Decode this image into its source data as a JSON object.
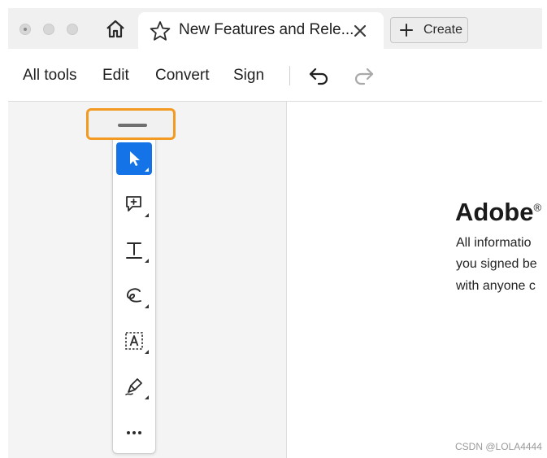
{
  "window": {
    "tab_title": "New Features and Rele...",
    "create_label": "Create"
  },
  "toolbar": {
    "items": [
      "All tools",
      "Edit",
      "Convert",
      "Sign"
    ]
  },
  "document": {
    "heading": "Adobe",
    "lines": [
      "All informatio",
      "you signed be",
      "with anyone c"
    ]
  },
  "rail": {
    "tools": [
      "select-icon",
      "add-comment-icon",
      "text-tool-icon",
      "draw-freehand-icon",
      "text-recognition-icon",
      "sign-pen-icon",
      "more-icon"
    ],
    "active_tool": "select-icon",
    "highlight_color": "#f39a23",
    "active_color": "#1473e6"
  },
  "watermark": "CSDN @LOLA4444"
}
